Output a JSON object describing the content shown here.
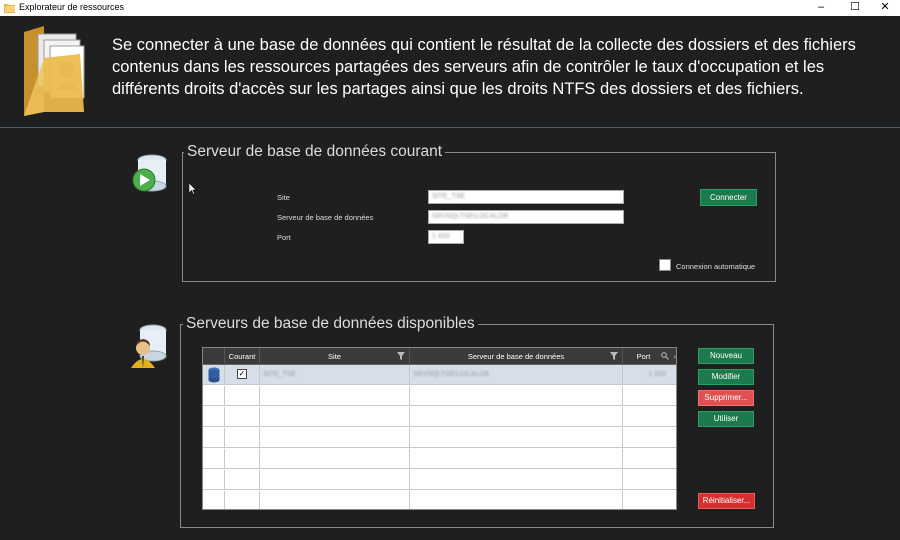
{
  "window": {
    "title": "Explorateur de ressources",
    "controls": {
      "minimize": "–",
      "maximize": "☐",
      "close": "✕"
    }
  },
  "intro_text": "Se connecter à une base de données qui contient le résultat de la collecte des dossiers et des fichiers contenus dans les ressources partagées des serveurs afin de contrôler le taux d'occupation et les différents droits d'accès sur les partages ainsi que les droits NTFS des dossiers et des fichiers.",
  "current_server": {
    "legend": "Serveur de base de données courant",
    "site_label": "Site",
    "site_value": "SITE_TSE",
    "server_label": "Serveur de base de données",
    "server_value": "SRVSQLTSE\\LOCALDB",
    "port_label": "Port",
    "port_value": "1 433",
    "connect_button": "Connecter",
    "auto_connect_label": "Connexion automatique",
    "auto_connect_checked": false
  },
  "available_servers": {
    "legend": "Serveurs de base de données disponibles",
    "columns": [
      "Courant",
      "Site",
      "Serveur de base de données",
      "Port"
    ],
    "rows": [
      {
        "courant": true,
        "site": "SITE_TSE",
        "serveur": "SRVSQLTSE\\LOCALDB",
        "port": "1 433"
      }
    ],
    "buttons": {
      "new": "Nouveau",
      "edit": "Modifier",
      "delete": "Supprimer...",
      "use": "Utiliser",
      "reset": "Réinitialiser..."
    }
  },
  "icons": {
    "app": "folder-icon",
    "header": "folder-documents-icon",
    "current_db": "database-connect-icon",
    "available_db": "database-user-icon",
    "filter": "filter-icon",
    "search": "search-icon"
  },
  "colors": {
    "background": "#1f1f1f",
    "green_button": "#1c7b4d",
    "red_button": "#e05050",
    "dark_red_button": "#d43030",
    "selected_row": "#d6dfe9"
  }
}
